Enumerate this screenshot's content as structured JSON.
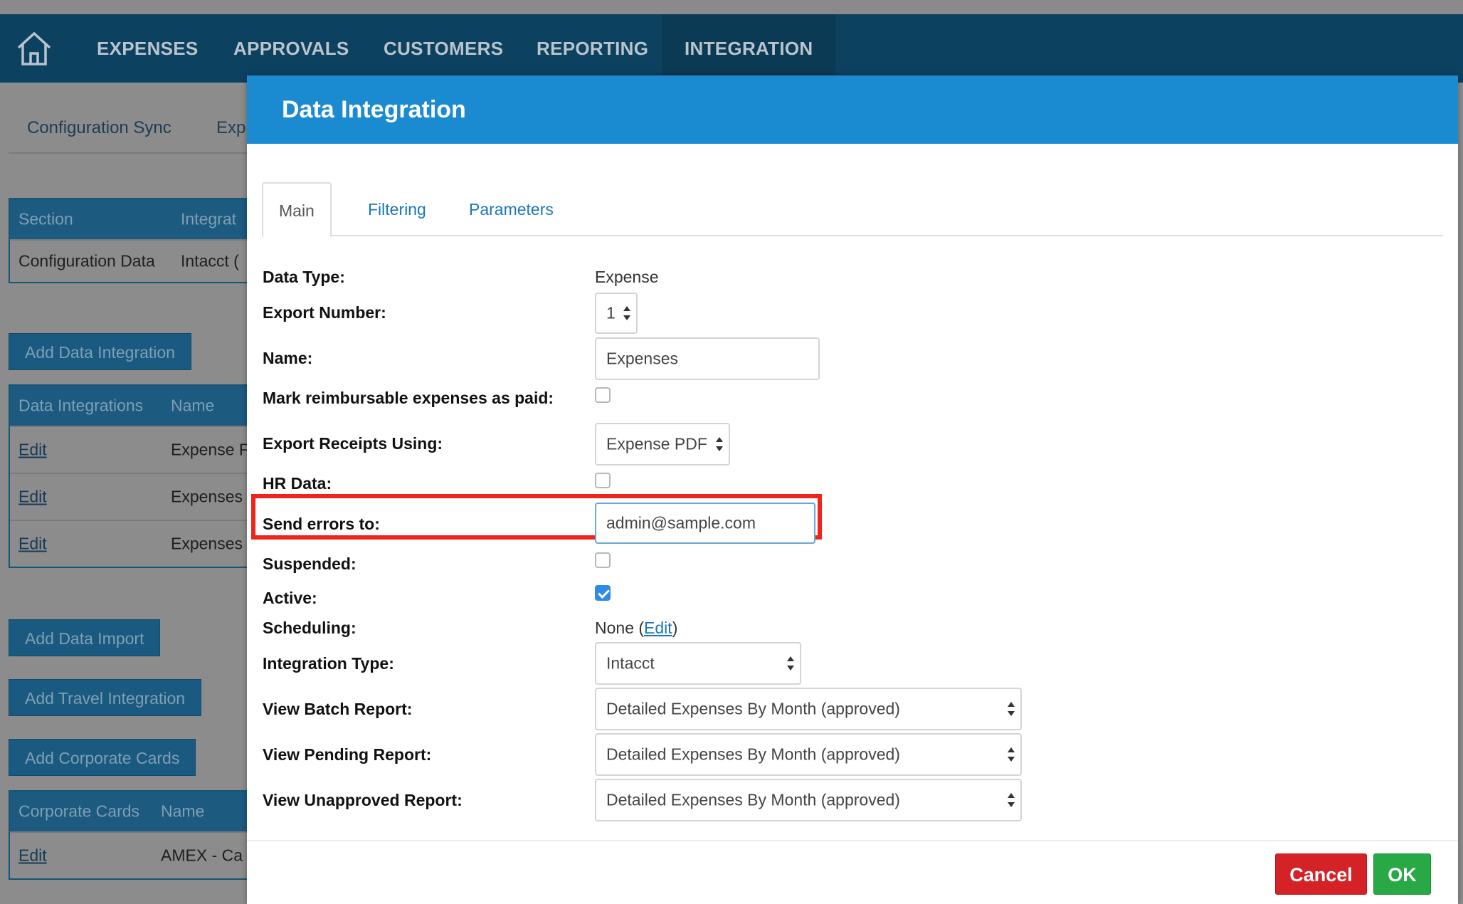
{
  "nav": {
    "items": [
      "EXPENSES",
      "APPROVALS",
      "CUSTOMERS",
      "REPORTING",
      "INTEGRATION"
    ],
    "active": "INTEGRATION"
  },
  "background": {
    "subnav": [
      "Configuration Sync",
      "Exp"
    ],
    "sections_table": {
      "headers": [
        "Section",
        "Integrat"
      ],
      "rows": [
        [
          "Configuration Data",
          "Intacct ("
        ]
      ]
    },
    "add_data_integration": "Add Data Integration",
    "integrations_table": {
      "headers": [
        "Data Integrations",
        "Name"
      ],
      "rows": [
        [
          "Edit",
          "Expense F"
        ],
        [
          "Edit",
          "Expenses"
        ],
        [
          "Edit",
          "Expenses"
        ]
      ]
    },
    "add_data_import": "Add Data Import",
    "add_travel_integration": "Add Travel Integration",
    "add_corporate_cards": "Add Corporate Cards",
    "cards_table": {
      "headers": [
        "Corporate Cards",
        "Name"
      ],
      "rows": [
        [
          "Edit",
          "AMEX - Ca"
        ]
      ]
    }
  },
  "modal": {
    "title": "Data Integration",
    "tabs": [
      "Main",
      "Filtering",
      "Parameters"
    ],
    "active_tab": "Main",
    "fields": {
      "data_type": {
        "label": "Data Type:",
        "value": "Expense"
      },
      "export_number": {
        "label": "Export Number:",
        "value": "1"
      },
      "name": {
        "label": "Name:",
        "value": "Expenses"
      },
      "mark_paid": {
        "label": "Mark reimbursable expenses as paid:",
        "checked": false
      },
      "export_receipts": {
        "label": "Export Receipts Using:",
        "value": "Expense PDF"
      },
      "hr_data": {
        "label": "HR Data:",
        "checked": false
      },
      "send_errors": {
        "label": "Send errors to:",
        "value": "admin@sample.com"
      },
      "suspended": {
        "label": "Suspended:",
        "checked": false
      },
      "active": {
        "label": "Active:",
        "checked": true
      },
      "scheduling": {
        "label": "Scheduling:",
        "value": "None",
        "open_paren": "(",
        "edit_link": "Edit",
        "close_paren": ")"
      },
      "integration_type": {
        "label": "Integration Type:",
        "value": "Intacct"
      },
      "batch_report": {
        "label": "View Batch Report:",
        "value": "Detailed Expenses By Month (approved)"
      },
      "pending_report": {
        "label": "View Pending Report:",
        "value": "Detailed Expenses By Month (approved)"
      },
      "unapproved_report": {
        "label": "View Unapproved Report:",
        "value": "Detailed Expenses By Month (approved)"
      }
    },
    "buttons": {
      "cancel": "Cancel",
      "ok": "OK"
    }
  },
  "colors": {
    "nav_bg": "#0d4160",
    "modal_header": "#1a8bd0",
    "highlight": "#f1241c",
    "cancel": "#d42227",
    "ok": "#28a946",
    "checkbox_checked": "#2f8ae6"
  }
}
